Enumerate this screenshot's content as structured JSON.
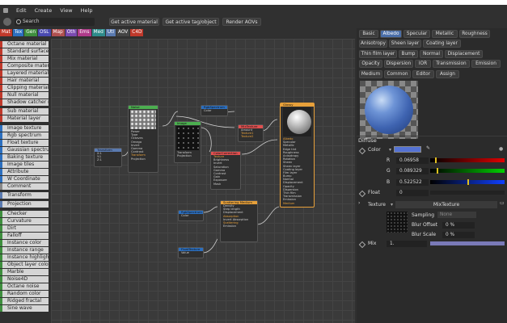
{
  "menu": {
    "items": [
      "Edit",
      "Create",
      "View",
      "Help"
    ]
  },
  "toolbar": {
    "search_label": "Search",
    "buttons": [
      "Get active material",
      "Get active tag/object",
      "Render AOVs"
    ]
  },
  "categories": [
    {
      "label": "Mat",
      "color": "#c0392b"
    },
    {
      "label": "Tex",
      "color": "#2c6fbf"
    },
    {
      "label": "Gen",
      "color": "#3e8e3e"
    },
    {
      "label": "OSL",
      "color": "#4a4ab0"
    },
    {
      "label": "Map",
      "color": "#b05050"
    },
    {
      "label": "Oth",
      "color": "#7a4ab0"
    },
    {
      "label": "Ems",
      "color": "#b03a8a"
    },
    {
      "label": "Med",
      "color": "#2e8b8b"
    },
    {
      "label": "Utl",
      "color": "#5a7ab0"
    },
    {
      "label": "AOV",
      "color": "#444444"
    },
    {
      "label": "C4D",
      "color": "#c0392b"
    }
  ],
  "node_list": [
    "Octane material",
    "Standard surface",
    "Mix material",
    "Composite materi",
    "Layered material",
    "Hair material",
    "Clipping material",
    "Null material",
    "Shadow catcher m",
    "Sub material",
    "Material layer",
    "Image texture",
    "Rgb spectrum",
    "Float texture",
    "Gaussian spectrur",
    "Baking texture",
    "Image tiles",
    "Attribute",
    "W Coordinate",
    "Comment",
    "Transform",
    "Projection",
    "Checker",
    "Curvature",
    "Dirt",
    "Falloff",
    "Instance color",
    "Instance range",
    "Instance highlight",
    "Object layer color",
    "Marble",
    "Noise4D",
    "Octane noise",
    "Random color",
    "Ridged fractal",
    "Sine wave"
  ],
  "nodes": {
    "noise": {
      "title": "Noise",
      "rows": [
        "Power",
        "Type",
        "Octaves",
        "Omega",
        "Invert",
        "Gamma",
        "Contrast",
        "Transform",
        "Projection"
      ]
    },
    "image": {
      "title": "Image",
      "rows": [
        "Transform",
        "Projection"
      ]
    },
    "transform": {
      "title": "Transform",
      "rows": [
        "X:1",
        "Y:1",
        "Z:1"
      ]
    },
    "rgbspec1": {
      "title": "RgbSpectrum",
      "rows": [
        "Color"
      ]
    },
    "mixtex": {
      "title": "MixTexture",
      "rows": [
        "Amount",
        "Texture1",
        "Texture2"
      ]
    },
    "colorcorr": {
      "title": "ColorCorrection",
      "rows": [
        "Texture",
        "Brightness",
        "Invert",
        "Saturation",
        "Gamma",
        "Contrast",
        "Gain",
        "Exposure",
        "Mask"
      ]
    },
    "glossy": {
      "title": "Glossy",
      "rows": [
        "Albedo",
        "Specular",
        "Metallic",
        "Edge tint",
        "Roughness",
        "Anisotropy",
        "Rotation",
        "Sheen",
        "Sheen layer",
        "Coating layer",
        "Film layer",
        "Bump",
        "Normal",
        "Displacement",
        "Opacity",
        "Dispersion",
        "Thin film",
        "Transmission",
        "Emission",
        "Medium"
      ]
    },
    "scattering": {
      "title": "Scattering Medium",
      "rows": [
        "Density",
        "Step length",
        "Displacement",
        "Absorption",
        "Invert Absorption",
        "Scattering",
        "Emission"
      ]
    },
    "rgbspec2": {
      "title": "RgbSpectrum",
      "rows": [
        "Color"
      ]
    },
    "floattex": {
      "title": "FloatTexture",
      "rows": [
        "Value"
      ]
    }
  },
  "panel": {
    "tabs_row1": [
      "Basic",
      "Albedo",
      "Specular",
      "Metallic",
      "Roughness"
    ],
    "tabs_row2": [
      "Anisotropy",
      "Sheen layer",
      "Coating layer"
    ],
    "tabs_row3": [
      "Thin film layer",
      "Bump",
      "Normal",
      "Displacement"
    ],
    "tabs_row4": [
      "Opacity",
      "Dispersion",
      "IOR",
      "Transmission",
      "Emission"
    ],
    "tabs_row5": [
      "Medium",
      "Common",
      "Editor",
      "Assign"
    ],
    "section": "Diffuse",
    "color_label": "Color",
    "color_swatch": "#5472d3",
    "r_label": "R",
    "r_value": "0.06958",
    "g_label": "G",
    "g_value": "0.089329",
    "b_label": "B",
    "b_value": "0.522522",
    "float_label": "Float",
    "float_value": "0",
    "texture_label": "Texture",
    "texture_value": "MixTexture",
    "sampling_label": "Sampling",
    "sampling_value": "None",
    "blur_offset_label": "Blur Offset",
    "blur_offset_value": "0 %",
    "blur_scale_label": "Blur Scale",
    "blur_scale_value": "0 %",
    "mix_label": "Mix",
    "mix_value": "1."
  }
}
